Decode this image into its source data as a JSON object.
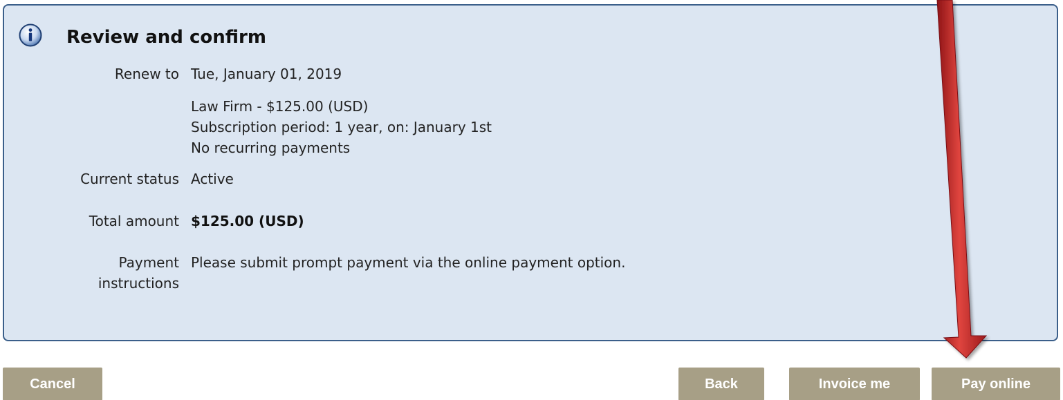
{
  "panel": {
    "title": "Review and confirm",
    "icon": "info-icon",
    "colors": {
      "background": "#dce6f2",
      "border": "#3b5f8a"
    }
  },
  "details": {
    "renew_to_label": "Renew to",
    "renew_to_value": "Tue, January 01, 2019",
    "level_line": "Law Firm - $125.00 (USD)",
    "period_line": "Subscription period: 1 year, on: January 1st",
    "recurring_line": "No recurring payments",
    "status_label": "Current status",
    "status_value": "Active",
    "total_label": "Total amount",
    "total_value": "$125.00 (USD)",
    "instructions_label_1": "Payment",
    "instructions_label_2": "instructions",
    "instructions_value": "Please submit prompt payment via the online payment option."
  },
  "buttons": {
    "cancel": "Cancel",
    "back": "Back",
    "invoice": "Invoice me",
    "pay": "Pay online",
    "color": "#a79f86"
  },
  "annotation": {
    "arrow_color": "#c0282a"
  }
}
